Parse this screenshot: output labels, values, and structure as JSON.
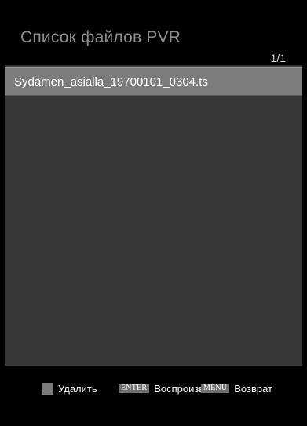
{
  "header": {
    "title": "Список файлов PVR",
    "page_indicator": "1/1"
  },
  "file_list": {
    "items": [
      {
        "name": "Sydämen_asialla_19700101_0304.ts",
        "selected": true
      }
    ]
  },
  "footer": {
    "hints": [
      {
        "key": "",
        "key_type": "color-key-gray",
        "label": "Удалить"
      },
      {
        "key": "ENTER",
        "key_type": "button-badge",
        "label": "Воспроизвести"
      },
      {
        "key": "MENU",
        "key_type": "button-badge",
        "label": "Возврат"
      }
    ]
  },
  "colors": {
    "background": "#000000",
    "list_area": "#373737",
    "selected_row": "#7c7c7c",
    "title_text": "#8e8e8e",
    "key_badge": "#6f6f6f"
  }
}
